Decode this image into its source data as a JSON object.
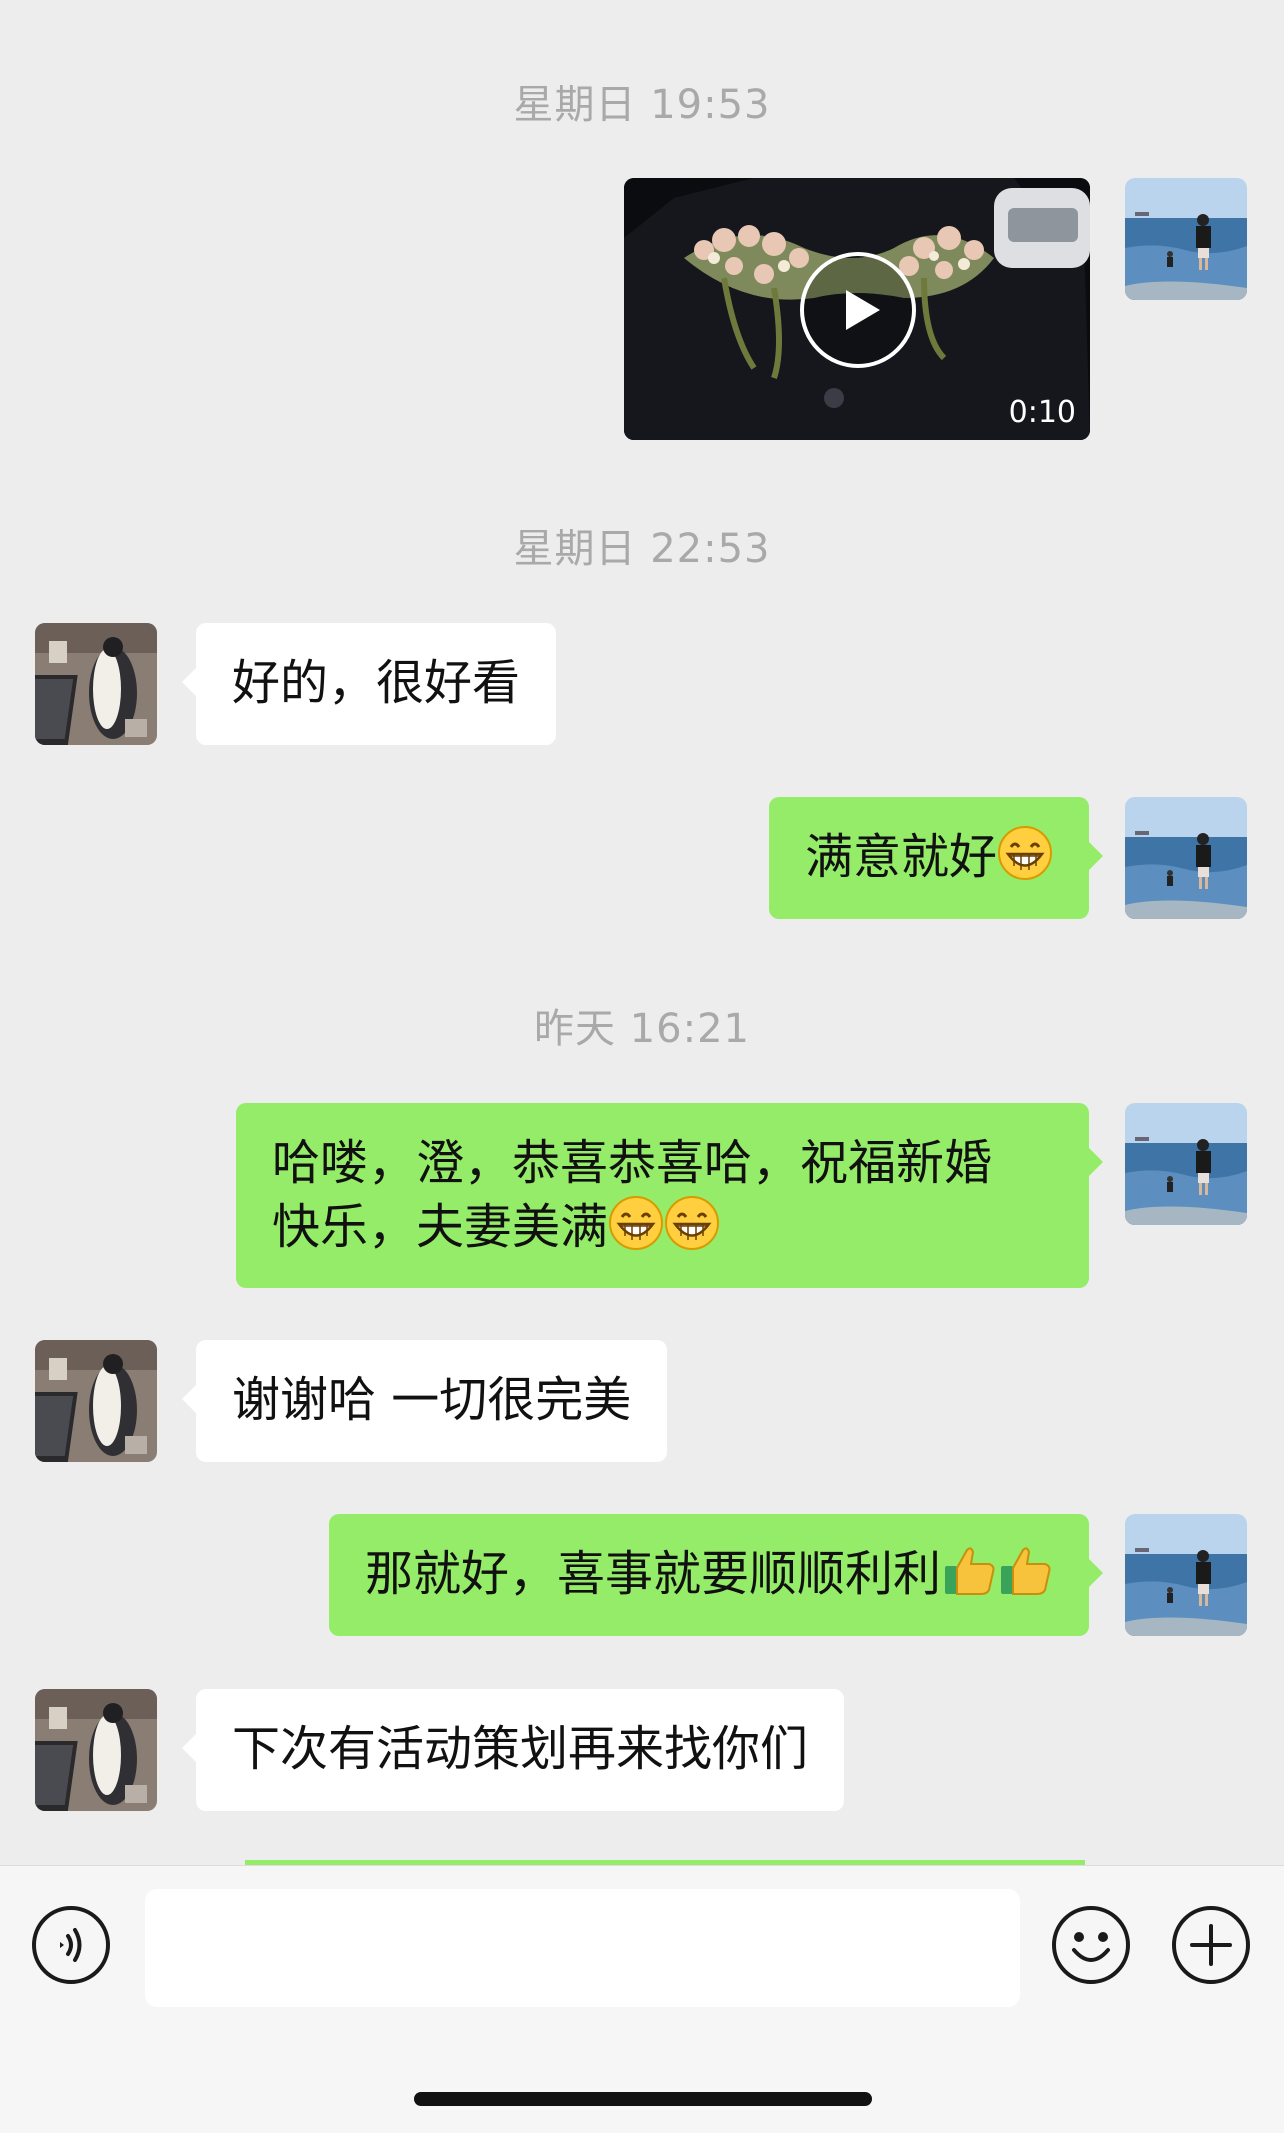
{
  "messages": {
    "ts1": "星期日 19:53",
    "video_duration": "0:10",
    "ts2": "星期日 22:53",
    "m1": "好的，很好看",
    "m2": "满意就好",
    "ts3": "昨天 16:21",
    "m3": "哈喽，澄，恭喜恭喜哈，祝福新婚\n快乐，夫妻美满",
    "m4": "谢谢哈 一切很完美",
    "m5": "那就好，喜事就要顺顺利利",
    "m6": "下次有活动策划再来找你们"
  },
  "input": {
    "placeholder": ""
  },
  "icons": {
    "voice": "voice-icon",
    "emoji": "emoji-icon",
    "more": "plus-icon",
    "grin": "grin-emoji",
    "thumbs": "thumbs-up-emoji",
    "play": "play-icon"
  },
  "colors": {
    "my_bubble": "#95ec69",
    "their_bubble": "#ffffff",
    "background": "#ededed",
    "timestamp": "#a9a9a9"
  }
}
